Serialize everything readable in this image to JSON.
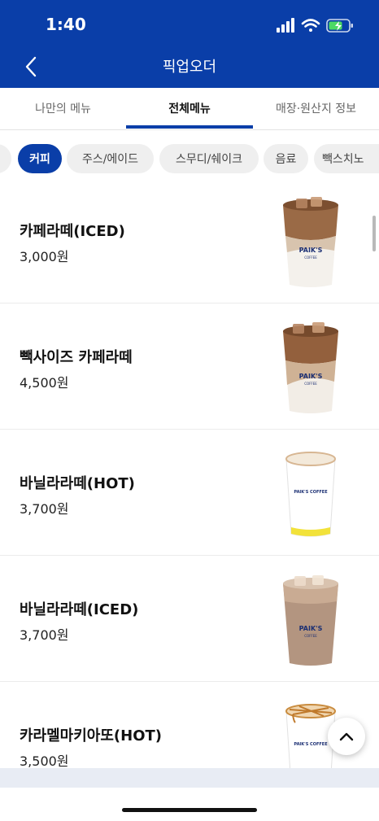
{
  "status_bar": {
    "time": "1:40"
  },
  "header": {
    "title": "픽업오더"
  },
  "tabs": [
    {
      "label": "나만의 메뉴"
    },
    {
      "label": "전체메뉴"
    },
    {
      "label": "매장·원산지 정보"
    }
  ],
  "categories": [
    {
      "label": ""
    },
    {
      "label": "커피"
    },
    {
      "label": "주스/에이드"
    },
    {
      "label": "스무디/쉐이크"
    },
    {
      "label": "음료"
    },
    {
      "label": "빽스치노"
    }
  ],
  "menu_items": [
    {
      "name": "카페라떼(ICED)",
      "price": "3,000원"
    },
    {
      "name": "빽사이즈 카페라떼",
      "price": "4,500원"
    },
    {
      "name": "바닐라라떼(HOT)",
      "price": "3,700원"
    },
    {
      "name": "바닐라라떼(ICED)",
      "price": "3,700원"
    },
    {
      "name": "카라멜마키아또(HOT)",
      "price": "3,500원"
    }
  ],
  "cup_labels": {
    "iced": "PAIK'S",
    "iced_sub": "COFFEE",
    "hot": "PAIK'S COFFEE"
  },
  "colors": {
    "brand": "#0a3ea8",
    "chip_bg": "#efefef"
  }
}
